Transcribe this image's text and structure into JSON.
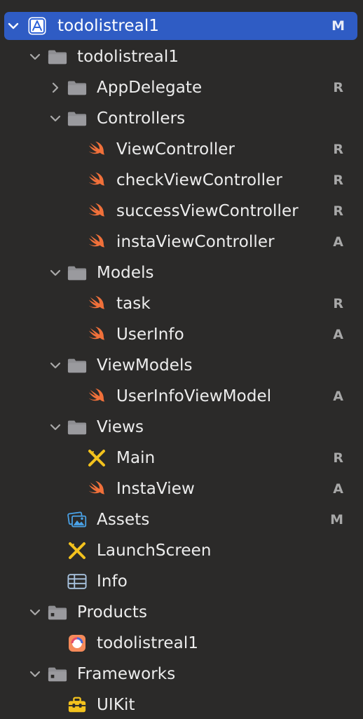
{
  "project": {
    "name": "todolistreal1",
    "status": "M"
  },
  "tree": [
    {
      "label": "todolistreal1",
      "status": "",
      "icon": "folder-icon"
    },
    {
      "label": "AppDelegate",
      "status": "R",
      "icon": "folder-icon"
    },
    {
      "label": "Controllers",
      "status": "",
      "icon": "folder-icon"
    },
    {
      "label": "ViewController",
      "status": "R",
      "icon": "swift-file-icon"
    },
    {
      "label": "checkViewController",
      "status": "R",
      "icon": "swift-file-icon"
    },
    {
      "label": "successViewController",
      "status": "R",
      "icon": "swift-file-icon"
    },
    {
      "label": "instaViewController",
      "status": "A",
      "icon": "swift-file-icon"
    },
    {
      "label": "Models",
      "status": "",
      "icon": "folder-icon"
    },
    {
      "label": "task",
      "status": "R",
      "icon": "swift-file-icon"
    },
    {
      "label": "UserInfo",
      "status": "A",
      "icon": "swift-file-icon"
    },
    {
      "label": "ViewModels",
      "status": "",
      "icon": "folder-icon"
    },
    {
      "label": "UserInfoViewModel",
      "status": "A",
      "icon": "swift-file-icon"
    },
    {
      "label": "Views",
      "status": "",
      "icon": "folder-icon"
    },
    {
      "label": "Main",
      "status": "R",
      "icon": "storyboard-icon"
    },
    {
      "label": "InstaView",
      "status": "A",
      "icon": "swift-file-icon"
    },
    {
      "label": "Assets",
      "status": "M",
      "icon": "asset-catalog-icon"
    },
    {
      "label": "LaunchScreen",
      "status": "",
      "icon": "storyboard-icon"
    },
    {
      "label": "Info",
      "status": "",
      "icon": "plist-table-icon"
    },
    {
      "label": "Products",
      "status": "",
      "icon": "folder-icon"
    },
    {
      "label": "todolistreal1",
      "status": "",
      "icon": "app-product-icon"
    },
    {
      "label": "Frameworks",
      "status": "",
      "icon": "folder-icon"
    },
    {
      "label": "UIKit",
      "status": "",
      "icon": "framework-toolbox-icon"
    }
  ],
  "colors": {
    "background": "#2b2a29",
    "selection": "#2f5cc4",
    "swift": "#f0703a",
    "folder": "#8e8e92",
    "storyboard": "#f3c21d",
    "asset": "#4aa3e8"
  }
}
